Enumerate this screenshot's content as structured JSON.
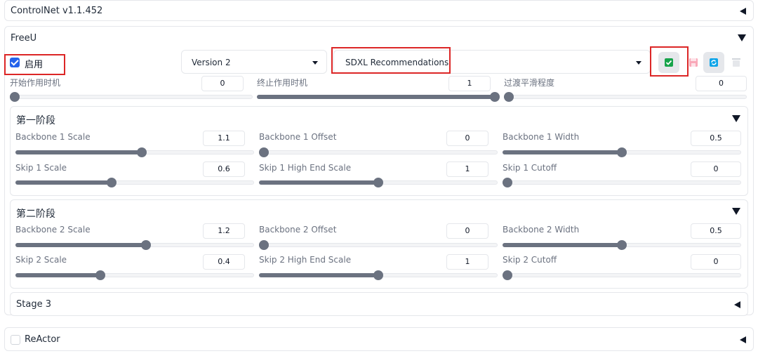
{
  "controlnet": {
    "title": "ControlNet v1.1.452"
  },
  "freeu": {
    "title": "FreeU",
    "enable_label": "启用",
    "enabled": true,
    "version_select": "Version 2",
    "preset_select": "SDXL Recommendations",
    "accent": "#2563eb",
    "global": [
      {
        "label": "开始作用时机",
        "value": "0",
        "fraction": 0.0
      },
      {
        "label": "终止作用时机",
        "value": "1",
        "fraction": 1.0
      },
      {
        "label": "过渡平滑程度",
        "value": "0",
        "fraction": 0.0
      }
    ]
  },
  "stage1": {
    "title": "第一阶段",
    "rows": [
      [
        {
          "label": "Backbone 1 Scale",
          "value": "1.1",
          "fraction": 0.53
        },
        {
          "label": "Backbone 1 Offset",
          "value": "0",
          "fraction": 0.0
        },
        {
          "label": "Backbone 1 Width",
          "value": "0.5",
          "fraction": 0.5
        }
      ],
      [
        {
          "label": "Skip 1 Scale",
          "value": "0.6",
          "fraction": 0.4
        },
        {
          "label": "Skip 1 High End Scale",
          "value": "1",
          "fraction": 0.5
        },
        {
          "label": "Skip 1 Cutoff",
          "value": "0",
          "fraction": 0.0
        }
      ]
    ]
  },
  "stage2": {
    "title": "第二阶段",
    "rows": [
      [
        {
          "label": "Backbone 2 Scale",
          "value": "1.2",
          "fraction": 0.55
        },
        {
          "label": "Backbone 2 Offset",
          "value": "0",
          "fraction": 0.0
        },
        {
          "label": "Backbone 2 Width",
          "value": "0.5",
          "fraction": 0.5
        }
      ],
      [
        {
          "label": "Skip 2 Scale",
          "value": "0.4",
          "fraction": 0.35
        },
        {
          "label": "Skip 2 High End Scale",
          "value": "1",
          "fraction": 0.5
        },
        {
          "label": "Skip 2 Cutoff",
          "value": "0",
          "fraction": 0.0
        }
      ]
    ]
  },
  "stage3": {
    "title": "Stage 3"
  },
  "reactor": {
    "title": "ReActor",
    "enabled": false
  }
}
